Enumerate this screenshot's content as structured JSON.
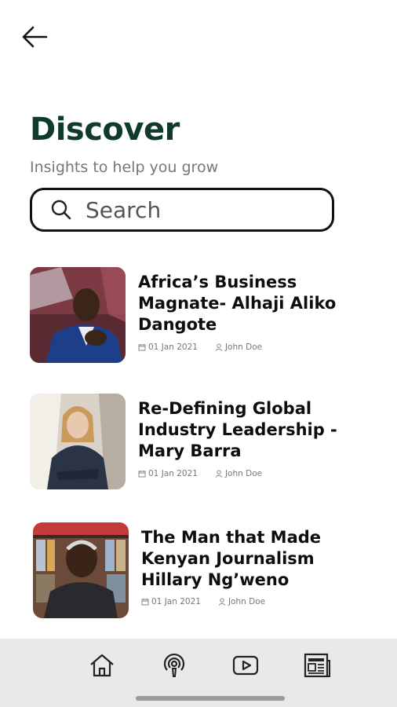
{
  "header": {
    "title": "Discover",
    "subtitle": "Insights to help you grow"
  },
  "search": {
    "placeholder": "Search",
    "value": ""
  },
  "articles": [
    {
      "title": "Africa’s Business Magnate- Alhaji Aliko Dangote",
      "date": "01 Jan 2021",
      "author": "John Doe"
    },
    {
      "title": "Re-Defining Global Industry Leadership - Mary Barra",
      "date": "01 Jan 2021",
      "author": "John Doe"
    },
    {
      "title": "The Man that Made Kenyan Journalism Hillary  Ng’weno",
      "date": "01 Jan 2021",
      "author": "John Doe"
    }
  ],
  "bottom_nav": {
    "items": [
      {
        "icon": "home-icon"
      },
      {
        "icon": "podcast-icon"
      },
      {
        "icon": "video-play-icon"
      },
      {
        "icon": "newspaper-icon"
      }
    ]
  },
  "colors": {
    "title": "#103a2f",
    "nav_background": "#e9e9e9"
  }
}
